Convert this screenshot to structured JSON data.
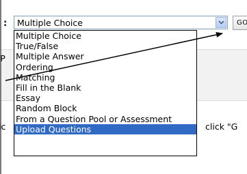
{
  "question_type": {
    "colon": ":",
    "selected": "Multiple Choice",
    "go_label": "GO",
    "options": [
      "Multiple Choice",
      "True/False",
      "Multiple Answer",
      "Ordering",
      "Matching",
      "Fill in the Blank",
      "Essay",
      "Random Block",
      "From a Question Pool or Assessment",
      "Upload Questions"
    ],
    "highlighted_index": 9
  },
  "background_fragments": {
    "left_fragment_upper": "ιР",
    "left_fragment_lower": "ic",
    "right_fragment": "click \"G"
  },
  "colors": {
    "highlight": "#316ac5",
    "border": "#7f9db9"
  },
  "icons": [
    "chevron-down-icon",
    "annotation-arrow"
  ]
}
